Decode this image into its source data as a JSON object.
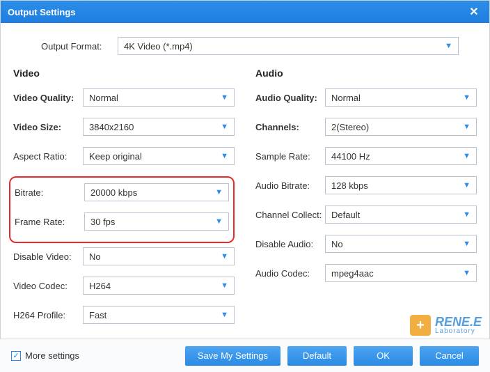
{
  "title": "Output Settings",
  "format": {
    "label": "Output Format:",
    "value": "4K Video (*.mp4)"
  },
  "video": {
    "title": "Video",
    "quality": {
      "label": "Video Quality:",
      "value": "Normal",
      "bold": true
    },
    "size": {
      "label": "Video Size:",
      "value": "3840x2160",
      "bold": true
    },
    "aspect": {
      "label": "Aspect Ratio:",
      "value": "Keep original"
    },
    "bitrate": {
      "label": "Bitrate:",
      "value": "20000 kbps"
    },
    "framerate": {
      "label": "Frame Rate:",
      "value": "30 fps"
    },
    "disable": {
      "label": "Disable Video:",
      "value": "No"
    },
    "codec": {
      "label": "Video Codec:",
      "value": "H264"
    },
    "profile": {
      "label": "H264 Profile:",
      "value": "Fast"
    }
  },
  "audio": {
    "title": "Audio",
    "quality": {
      "label": "Audio Quality:",
      "value": "Normal",
      "bold": true
    },
    "channels": {
      "label": "Channels:",
      "value": "2(Stereo)",
      "bold": true
    },
    "samplerate": {
      "label": "Sample Rate:",
      "value": "44100 Hz"
    },
    "bitrate": {
      "label": "Audio Bitrate:",
      "value": "128 kbps"
    },
    "collect": {
      "label": "Channel Collect:",
      "value": "Default"
    },
    "disable": {
      "label": "Disable Audio:",
      "value": "No"
    },
    "codec": {
      "label": "Audio Codec:",
      "value": "mpeg4aac"
    }
  },
  "footer": {
    "more": "More settings",
    "save": "Save My Settings",
    "default": "Default",
    "ok": "OK",
    "cancel": "Cancel"
  },
  "watermark": {
    "brand": "RENE.E",
    "sub": "Laboratory"
  }
}
